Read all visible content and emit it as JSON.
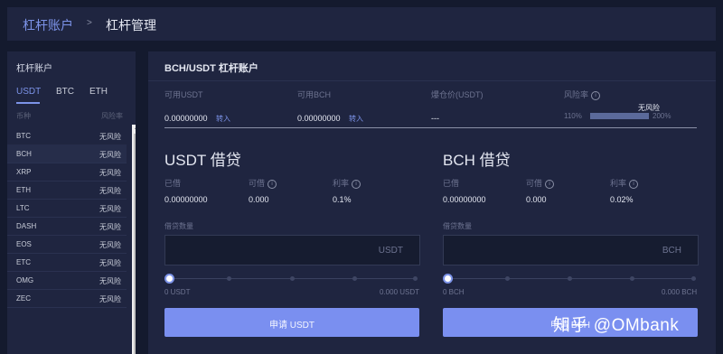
{
  "breadcrumb": {
    "parent": "杠杆账户",
    "sep": ">",
    "current": "杠杆管理"
  },
  "sidebar": {
    "title": "杠杆账户",
    "tabs": [
      "USDT",
      "BTC",
      "ETH"
    ],
    "col_currency": "币种",
    "col_risk": "风险率",
    "rows": [
      {
        "coin": "BTC",
        "risk": "无风险"
      },
      {
        "coin": "BCH",
        "risk": "无风险"
      },
      {
        "coin": "XRP",
        "risk": "无风险"
      },
      {
        "coin": "ETH",
        "risk": "无风险"
      },
      {
        "coin": "LTC",
        "risk": "无风险"
      },
      {
        "coin": "DASH",
        "risk": "无风险"
      },
      {
        "coin": "EOS",
        "risk": "无风险"
      },
      {
        "coin": "ETC",
        "risk": "无风险"
      },
      {
        "coin": "OMG",
        "risk": "无风险"
      },
      {
        "coin": "ZEC",
        "risk": "无风险"
      }
    ]
  },
  "main": {
    "title": "BCH/USDT 杠杆账户",
    "available_usdt_label": "可用USDT",
    "available_usdt_value": "0.00000000",
    "available_bch_label": "可用BCH",
    "available_bch_value": "0.00000000",
    "transfer_label": "转入",
    "liq_price_label": "爆仓价(USDT)",
    "liq_price_value": "---",
    "risk_label": "风险率",
    "risk_status": "无风险",
    "risk_min": "110%",
    "risk_max": "200%"
  },
  "loans": [
    {
      "title": "USDT 借贷",
      "borrowed_label": "已借",
      "borrowed": "0.00000000",
      "avail_label": "可借",
      "avail": "0.000",
      "rate_label": "利率",
      "rate": "0.1%",
      "amount_label": "借贷数量",
      "unit": "USDT",
      "slider_min": "0 USDT",
      "slider_max": "0.000 USDT",
      "button": "申请 USDT"
    },
    {
      "title": "BCH 借贷",
      "borrowed_label": "已借",
      "borrowed": "0.00000000",
      "avail_label": "可借",
      "avail": "0.000",
      "rate_label": "利率",
      "rate": "0.02%",
      "amount_label": "借贷数量",
      "unit": "BCH",
      "slider_min": "0 BCH",
      "slider_max": "0.000 BCH",
      "button": "申请 BCH"
    }
  ],
  "watermark": "知乎 @OMbank",
  "colors": {
    "accent": "#7c93e8",
    "panel": "#1f2540",
    "background": "#141a2e",
    "button": "#7a8ff0"
  }
}
